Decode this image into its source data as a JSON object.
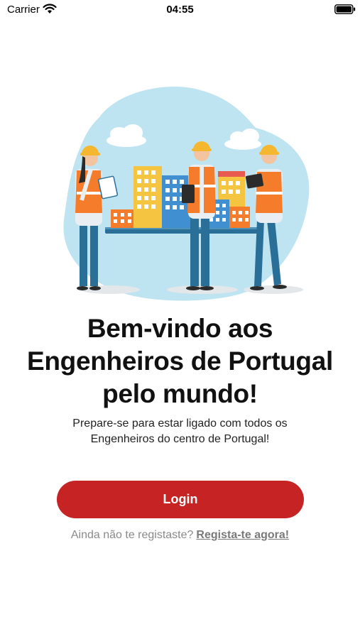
{
  "status_bar": {
    "carrier": "Carrier",
    "time": "04:55",
    "wifi_icon": "wifi-icon",
    "battery_icon": "battery-icon"
  },
  "hero": {
    "illustration": "engineers-illustration",
    "colors": {
      "blob": "#bfe4f1",
      "vest": "#f47c2a",
      "helmet": "#f5b730",
      "trousers": "#2a6f97"
    }
  },
  "welcome": {
    "title_line1": "Bem-vindo aos",
    "title_line2": "Engenheiros de Portugal",
    "title_line3": "pelo mundo!",
    "subtitle_line1": "Prepare-se para estar ligado com todos os",
    "subtitle_line2": "Engenheiros do centro de Portugal!"
  },
  "actions": {
    "login_label": "Login",
    "register_prompt": "Ainda não te registaste?",
    "register_link": "Regista-te agora!"
  },
  "colors": {
    "primary": "#c62325",
    "muted_text": "#8a8a8a",
    "text": "#111111"
  }
}
